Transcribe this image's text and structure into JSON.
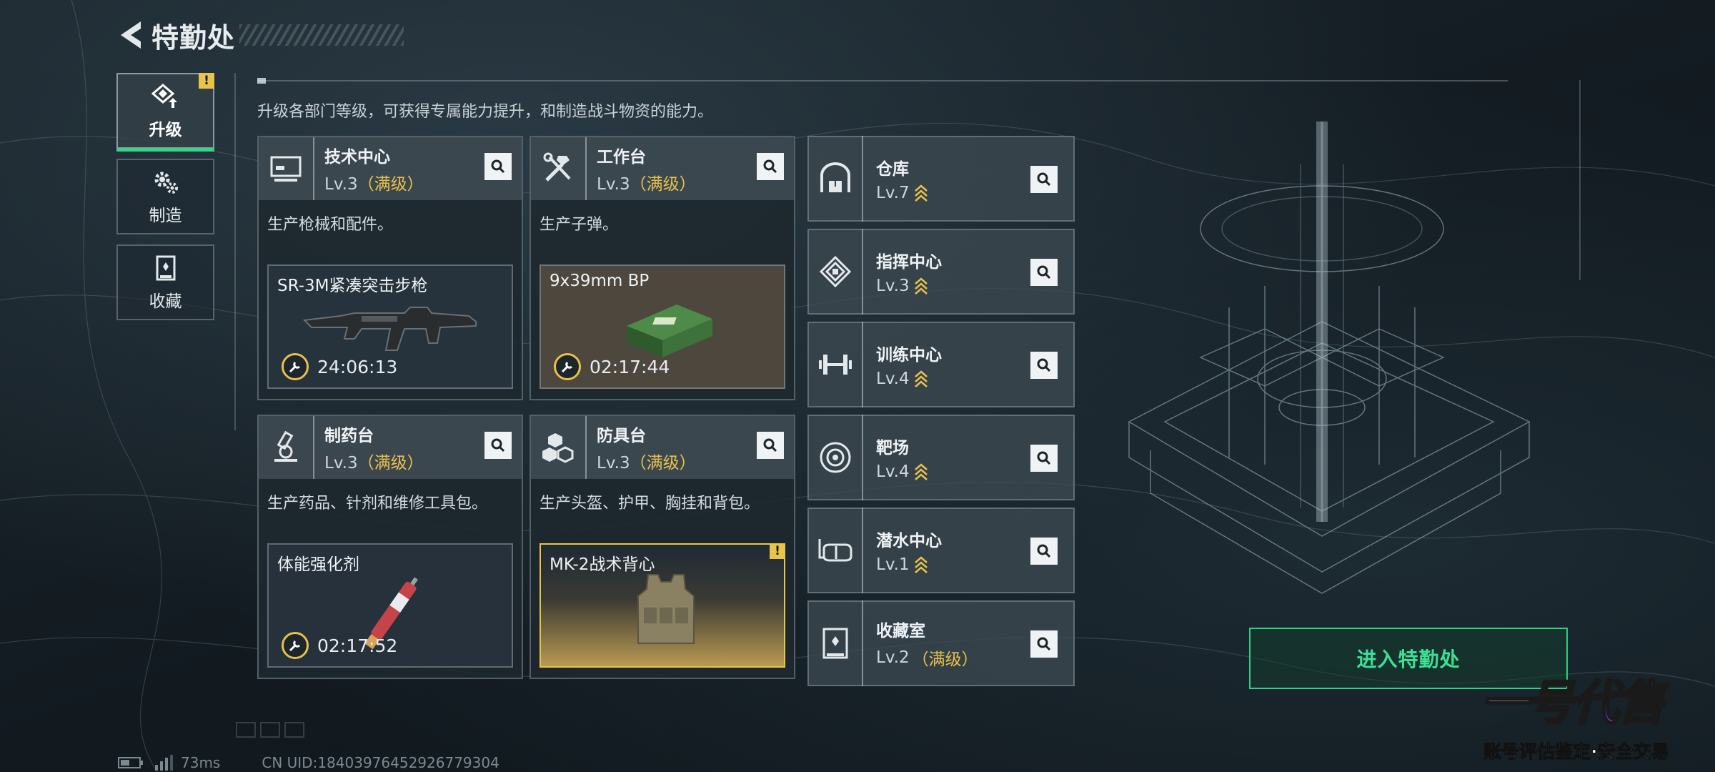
{
  "header": {
    "title": "特勤处"
  },
  "nav": [
    {
      "label": "升级",
      "icon": "upgrade-icon",
      "active": true,
      "alert": "!"
    },
    {
      "label": "制造",
      "icon": "gears-icon",
      "active": false
    },
    {
      "label": "收藏",
      "icon": "collection-icon",
      "active": false
    }
  ],
  "subtitle": "升级各部门等级，可获得专属能力提升，和制造战斗物资的能力。",
  "cards": [
    {
      "name": "技术中心",
      "level": "Lv.3",
      "max": "（满级）",
      "desc": "生产枪械和配件。",
      "item": "SR-3M紧凑突击步枪",
      "timer": "24:06:13"
    },
    {
      "name": "工作台",
      "level": "Lv.3",
      "max": "（满级）",
      "desc": "生产子弹。",
      "item": "9x39mm BP",
      "timer": "02:17:44"
    },
    {
      "name": "制药台",
      "level": "Lv.3",
      "max": "（满级）",
      "desc": "生产药品、针剂和维修工具包。",
      "item": "体能强化剂",
      "timer": "02:17:52"
    },
    {
      "name": "防具台",
      "level": "Lv.3",
      "max": "（满级）",
      "desc": "生产头盔、护甲、胸挂和背包。",
      "item": "MK-2战术背心",
      "alert": "!"
    }
  ],
  "facilities": [
    {
      "name": "仓库",
      "level": "Lv.7",
      "max": ""
    },
    {
      "name": "指挥中心",
      "level": "Lv.3",
      "max": ""
    },
    {
      "name": "训练中心",
      "level": "Lv.4",
      "max": ""
    },
    {
      "name": "靶场",
      "level": "Lv.4",
      "max": ""
    },
    {
      "name": "潜水中心",
      "level": "Lv.1",
      "max": ""
    },
    {
      "name": "收藏室",
      "level": "Lv.2",
      "max": "（满级）"
    }
  ],
  "enter_button": "进入特勤处",
  "footer": {
    "ping": "73ms",
    "uid": "CN UID:18403976452926779304"
  },
  "watermark": {
    "logo_a": "一号",
    "logo_b": "代售",
    "slogan": "账号评估鉴定·安全交易"
  },
  "colors": {
    "accent_green": "#35d486",
    "gold": "#e8c14b"
  }
}
